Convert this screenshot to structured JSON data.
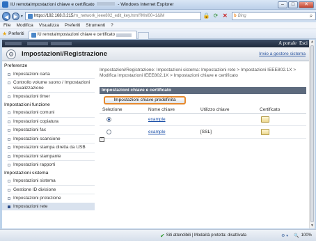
{
  "window": {
    "title": "IU remotaImpostazioni chiave e certificato",
    "title_suffix": "- Windows Internet Explorer",
    "minimize": "–",
    "maximize": "□",
    "close": "✕"
  },
  "address": {
    "url_main": "https://192.168.0.215",
    "url_rest": "/rn_network_ieee802_edit_key.html?Mnl00=1&iM",
    "search_placeholder": "Bing"
  },
  "menu": [
    "File",
    "Modifica",
    "Visualizza",
    "Preferiti",
    "Strumenti",
    "?"
  ],
  "favorites": {
    "label": "Preferiti",
    "tab_title": "IU remotaImpostazioni chiave e certificato"
  },
  "topbar": {
    "portal": "A portale",
    "exit": "Esci"
  },
  "header": {
    "title": "Impostazioni/Registrazione",
    "send_to_manager": "Invio a gestore sistema"
  },
  "sidebar": {
    "sections": [
      {
        "label": "Preferenze",
        "items": [
          "Impostazioni carta",
          "Controllo volume suono / Impostazioni visualizzazione",
          "Impostazioni timer"
        ]
      },
      {
        "label": "Impostazioni funzione",
        "items": [
          "Impostazioni comuni",
          "Impostazioni copiatura",
          "Impostazioni fax",
          "Impostazioni scansione",
          "Impostazioni stampa diretta da USB",
          "Impostazioni stampante",
          "Impostazioni rapporti"
        ]
      },
      {
        "label": "Impostazioni sistema",
        "items": [
          "Impostazioni sistema",
          "Gestione ID divisione",
          "Impostazioni protezione",
          "Impostazioni rete"
        ]
      }
    ],
    "active_item": "Impostazioni rete"
  },
  "content": {
    "breadcrumb": "Impostazioni/Registrazione: Impostazioni sistema: Impostazioni rete > Impostazioni IEEE802.1X > Modifica impostazioni IEEE802.1X > Impostazioni chiave e certificato",
    "section_title": "Impostazioni chiave e certificato",
    "default_key_button": "Impostazioni chiave predefinita",
    "table": {
      "columns": [
        "Selezione",
        "Nome chiave",
        "Utilizzo chiave",
        "Certificato"
      ],
      "rows": [
        {
          "selected": true,
          "key_name": "example",
          "usage": "",
          "certificate_icon": "certificate-icon"
        },
        {
          "selected": false,
          "key_name": "example",
          "usage": "[SSL]",
          "certificate_icon": "certificate-icon"
        }
      ]
    }
  },
  "status": {
    "zone": "Siti attendibili | Modalità protetta: disattivata",
    "zoom": "100%"
  },
  "colors": {
    "accent_button_border": "#e6892d",
    "section_bar": "#5d6a7d",
    "link": "#1a4fa8"
  }
}
